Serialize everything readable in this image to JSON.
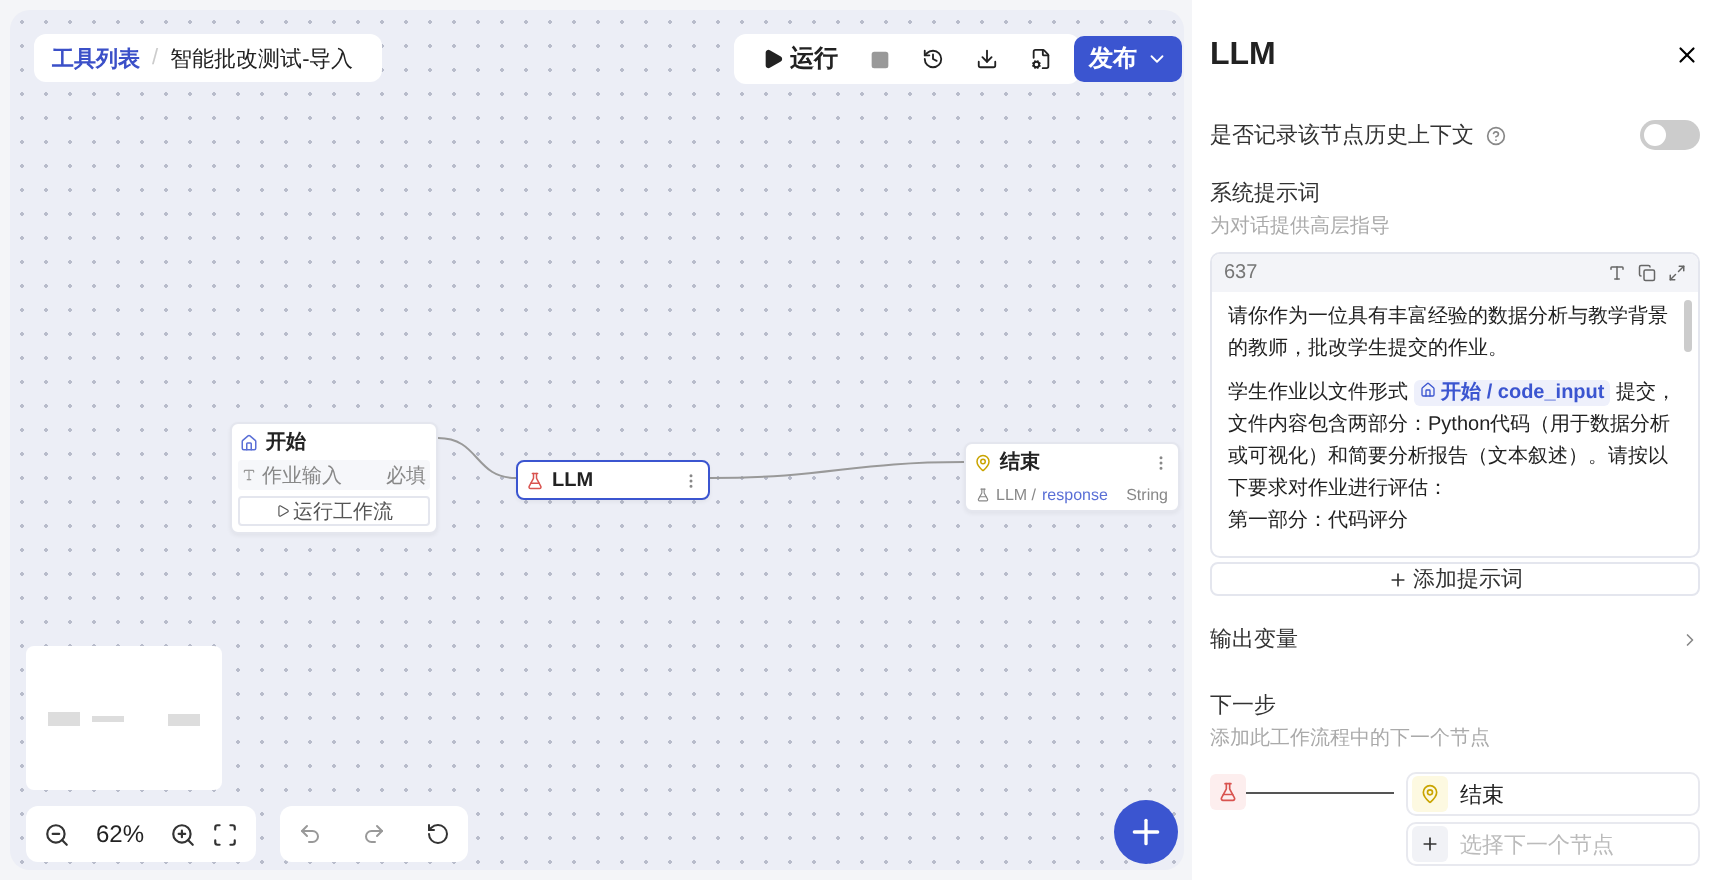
{
  "breadcrumb": {
    "root": "工具列表",
    "current": "智能批改测试-导入",
    "separator": "/"
  },
  "toolbar": {
    "run": "运行",
    "publish": "发布"
  },
  "nodes": [
    {
      "kind": "start",
      "title": "开始",
      "field": "作业输入",
      "required": "必填",
      "action": "运行工作流",
      "selected": false
    },
    {
      "kind": "llm",
      "title": "LLM",
      "selected": true
    },
    {
      "kind": "end",
      "title": "结束",
      "ref_node": "LLM /",
      "ref_var": "response",
      "type": "String",
      "selected": false
    }
  ],
  "zoom": "62%",
  "panel": {
    "title": "LLM",
    "history_label": "是否记录该节点历史上下文",
    "history_on": false,
    "prompt_label": "系统提示词",
    "prompt_hint": "为对话提供高层指导",
    "count": "637",
    "paragraphs": [
      {
        "parts": [
          {
            "kind": "text",
            "text": "请你作为一位具有丰富经验的数据分析与教学背景的教师，批改学生提交的作业。"
          }
        ]
      },
      {
        "parts": [
          {
            "kind": "text",
            "text": "学生作业以文件形式 "
          },
          {
            "kind": "var",
            "text": "开始 / code_input"
          },
          {
            "kind": "text",
            "text": " 提交，文件内容包含两部分：Python代码（用于数据分析或可视化）和简要分析报告（文本叙述）。请按以下要求对作业进行评估："
          },
          {
            "kind": "break"
          },
          {
            "kind": "text",
            "text": "第一部分：代码评分"
          }
        ]
      }
    ],
    "add_prompt": "添加提示词",
    "output_label": "输出变量",
    "next_label": "下一步",
    "next_hint": "添加此工作流程中的下一个节点",
    "next_target": "结束",
    "next_placeholder": "选择下一个节点"
  }
}
